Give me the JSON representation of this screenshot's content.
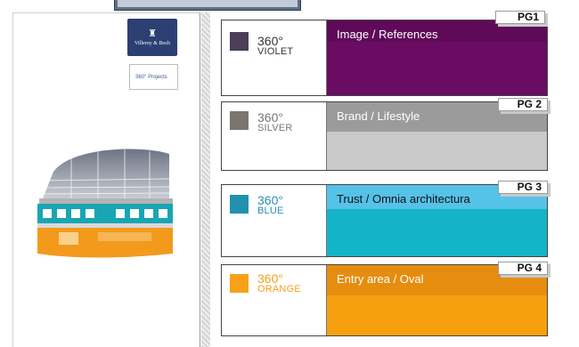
{
  "logos": {
    "villeroy_boch": "Villeroy & Boch",
    "projects_360": "360° Projects"
  },
  "cards": [
    {
      "badge": "PG1",
      "number": "360°",
      "name": "VIOLET",
      "label": "Image / References",
      "swatch": "#4a3f56",
      "num_color": "#333333",
      "top_color": "#5e0a58",
      "bottom_color": "#6a0c62",
      "label_color": "#ffffff"
    },
    {
      "badge": "PG 2",
      "number": "360°",
      "name": "SILVER",
      "label": "Brand / Lifestyle",
      "swatch": "#7b7570",
      "num_color": "#777777",
      "top_color": "#9b9b9b",
      "bottom_color": "#c9c9c9",
      "label_color": "#ffffff"
    },
    {
      "badge": "PG 3",
      "number": "360°",
      "name": "BLUE",
      "label": "Trust / Omnia architectura",
      "swatch": "#2391ae",
      "num_color": "#2a8fb0",
      "top_color": "#55c2e8",
      "bottom_color": "#14b4c8",
      "label_color": "#111111"
    },
    {
      "badge": "PG 4",
      "number": "360°",
      "name": "ORANGE",
      "label": "Entry area / Oval",
      "swatch": "#f7a11a",
      "num_color": "#f5a01b",
      "top_color": "#e68d10",
      "bottom_color": "#f7a00f",
      "label_color": "#ffffff"
    }
  ]
}
